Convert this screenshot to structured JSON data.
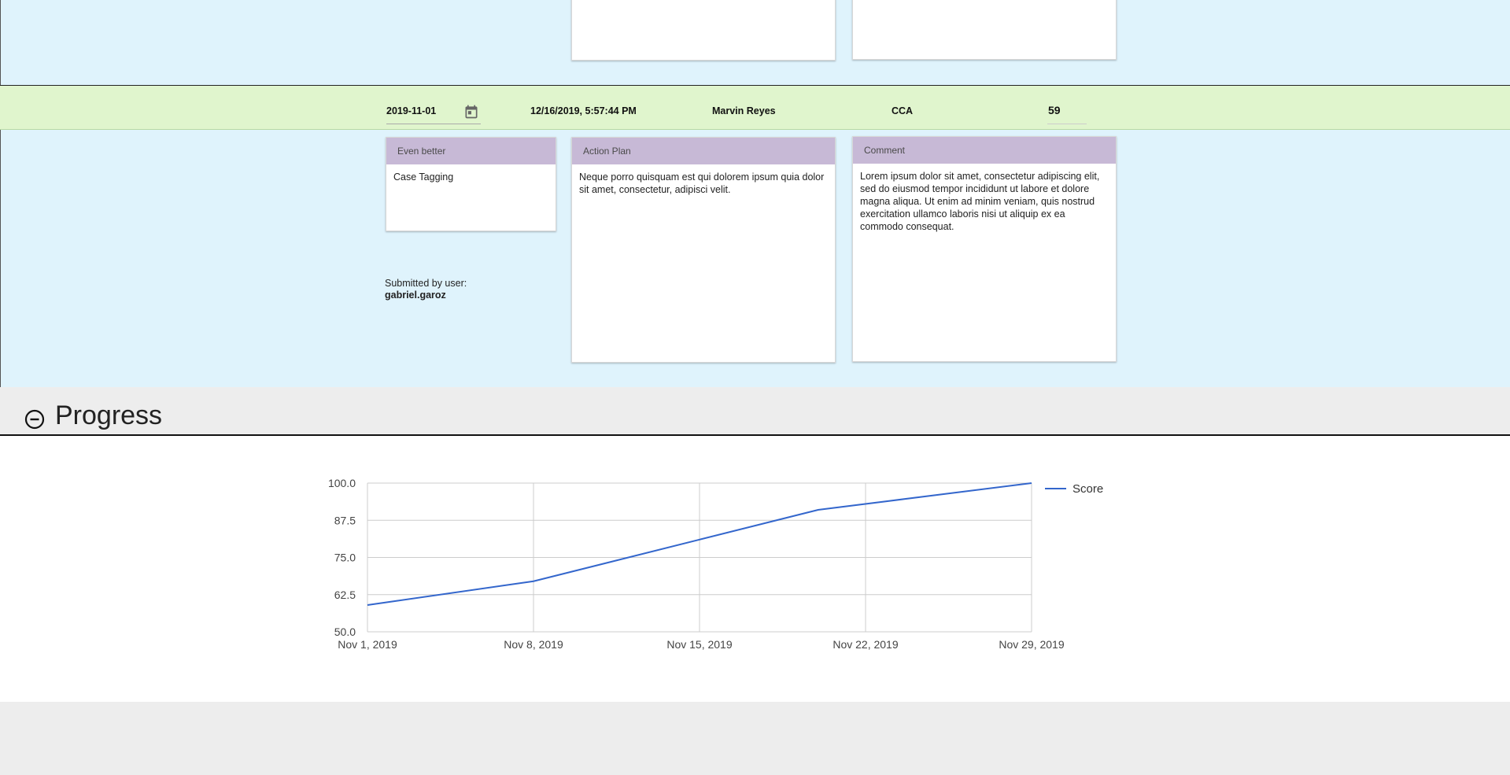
{
  "entry": {
    "date_value": "2019-11-01",
    "timestamp": "12/16/2019, 5:57:44 PM",
    "agent": "Marvin Reyes",
    "type": "CCA",
    "score": "59"
  },
  "cards": {
    "even_better": {
      "header": "Even better",
      "body": "Case Tagging"
    },
    "action_plan": {
      "header": "Action Plan",
      "body": "Neque porro quisquam est qui dolorem ipsum quia dolor sit amet, consectetur, adipisci velit."
    },
    "comment": {
      "header": "Comment",
      "body": "Lorem ipsum dolor sit amet, consectetur adipiscing elit, sed do eiusmod tempor incididunt ut labore et dolore magna aliqua. Ut enim ad minim veniam, quis nostrud exercitation ullamco laboris nisi ut aliquip ex ea commodo consequat."
    }
  },
  "submitted": {
    "label": "Submitted by user:",
    "user": "gabriel.garoz"
  },
  "progress": {
    "title": "Progress",
    "collapse_icon": "minus-circle-icon"
  },
  "colors": {
    "accent_line": "#3366cc",
    "card_header": "#c7b9d6",
    "row_green": "#e0f5cd",
    "panel_blue": "#dff3fc"
  },
  "chart_data": {
    "type": "line",
    "x": [
      "2019-11-01",
      "2019-11-08",
      "2019-11-15",
      "2019-11-20",
      "2019-11-29"
    ],
    "x_tick_labels": [
      "Nov 1, 2019",
      "Nov 8, 2019",
      "Nov 15, 2019",
      "Nov 22, 2019",
      "Nov 29, 2019"
    ],
    "y_tick_labels": [
      "100.0",
      "87.5",
      "75.0",
      "62.5",
      "50.0"
    ],
    "ylim": [
      50,
      100
    ],
    "grid": true,
    "legend": "right",
    "series": [
      {
        "name": "Score",
        "values": [
          59,
          67,
          81,
          91,
          100
        ]
      }
    ]
  }
}
